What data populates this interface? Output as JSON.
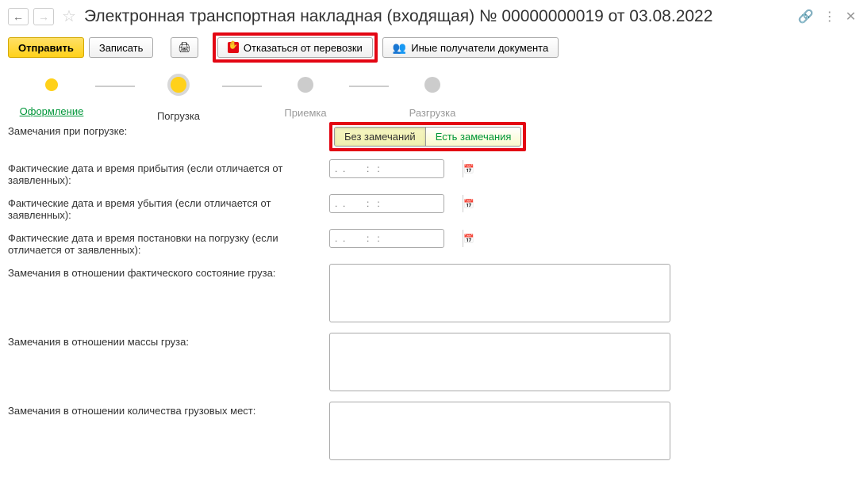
{
  "header": {
    "title": "Электронная транспортная накладная (входящая) № 00000000019 от 03.08.2022"
  },
  "toolbar": {
    "send": "Отправить",
    "save": "Записать",
    "refuse": "Отказаться от перевозки",
    "other_recipients": "Иные получатели документа"
  },
  "stepper": {
    "step1": "Оформление",
    "step2": "Погрузка",
    "step3": "Приемка",
    "step4": "Разгрузка"
  },
  "form": {
    "remarks_label": "Замечания при погрузке:",
    "toggle_no": "Без замечаний",
    "toggle_yes": "Есть замечания",
    "arrival_label": "Фактические дата и время прибытия (если отличается от заявленных):",
    "departure_label": "Фактические дата и время убытия (если отличается от заявленных):",
    "loading_label": "Фактические дата и время постановки на погрузку (если отличается от заявленных):",
    "date_placeholder": ".  .        :   :",
    "state_label": "Замечания в отношении фактического состояние груза:",
    "mass_label": "Замечания в отношении массы груза:",
    "places_label": "Замечания в отношении количества грузовых мест:"
  }
}
